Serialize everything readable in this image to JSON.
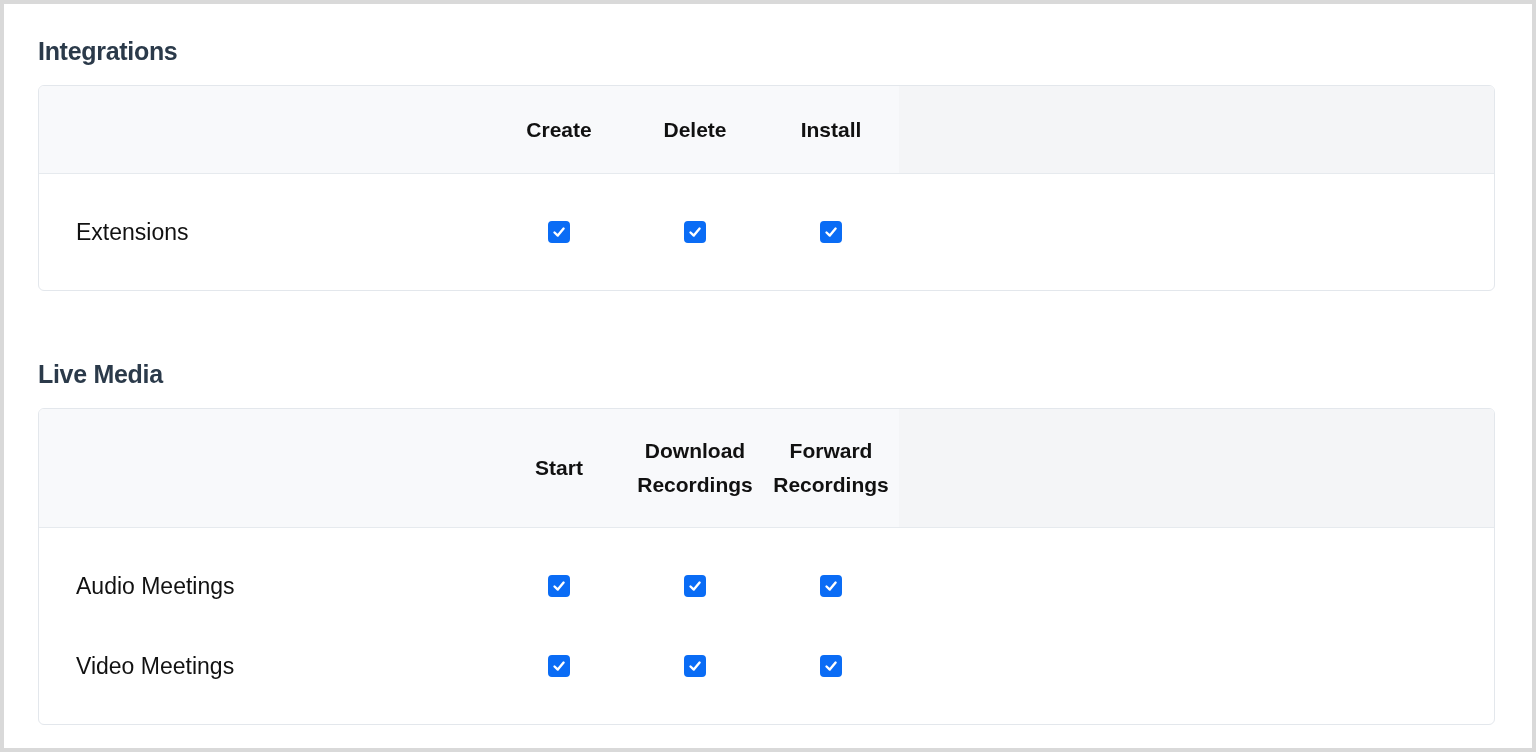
{
  "sections": [
    {
      "title": "Integrations",
      "columns": [
        "Create",
        "Delete",
        "Install"
      ],
      "rows": [
        {
          "label": "Extensions",
          "checks": [
            {
              "checked": true
            },
            {
              "checked": true
            },
            {
              "checked": true
            }
          ]
        }
      ]
    },
    {
      "title": "Live Media",
      "columns": [
        "Start",
        "Download Recordings",
        "Forward Recordings"
      ],
      "rows": [
        {
          "label": "Audio Meetings",
          "checks": [
            {
              "checked": true
            },
            {
              "checked": true
            },
            {
              "checked": true
            }
          ]
        },
        {
          "label": "Video Meetings",
          "checks": [
            {
              "checked": true
            },
            {
              "checked": true
            },
            {
              "checked": true
            }
          ]
        }
      ]
    }
  ]
}
